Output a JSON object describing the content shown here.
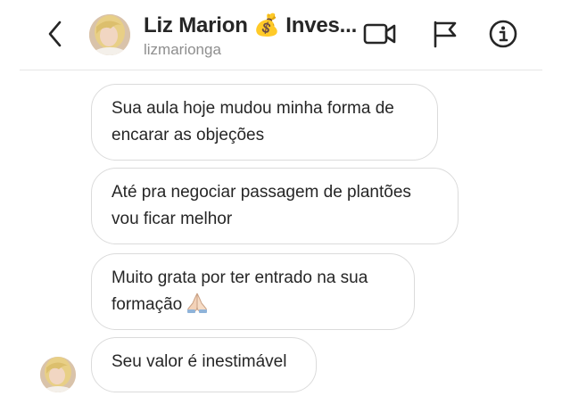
{
  "header": {
    "title": "Liz Marion 💰 Inves...",
    "username": "lizmarionga",
    "icons": {
      "back": "chevron-left-icon",
      "video": "video-camera-icon",
      "flag": "flag-icon",
      "info": "info-icon"
    }
  },
  "messages": [
    {
      "text": "Sua aula hoje mudou minha forma de encarar as objeções"
    },
    {
      "text": "Até pra negociar passagem de plantões vou ficar melhor"
    },
    {
      "text": "Muito grata por ter entrado na sua formação",
      "emoji": "praying-hands-icon"
    },
    {
      "text": "Seu valor é inestimável"
    }
  ],
  "colors": {
    "text": "#262626",
    "secondary_text": "#8e8e8e",
    "bubble_border": "#dbdbdb",
    "divider": "#e6e6e6"
  }
}
